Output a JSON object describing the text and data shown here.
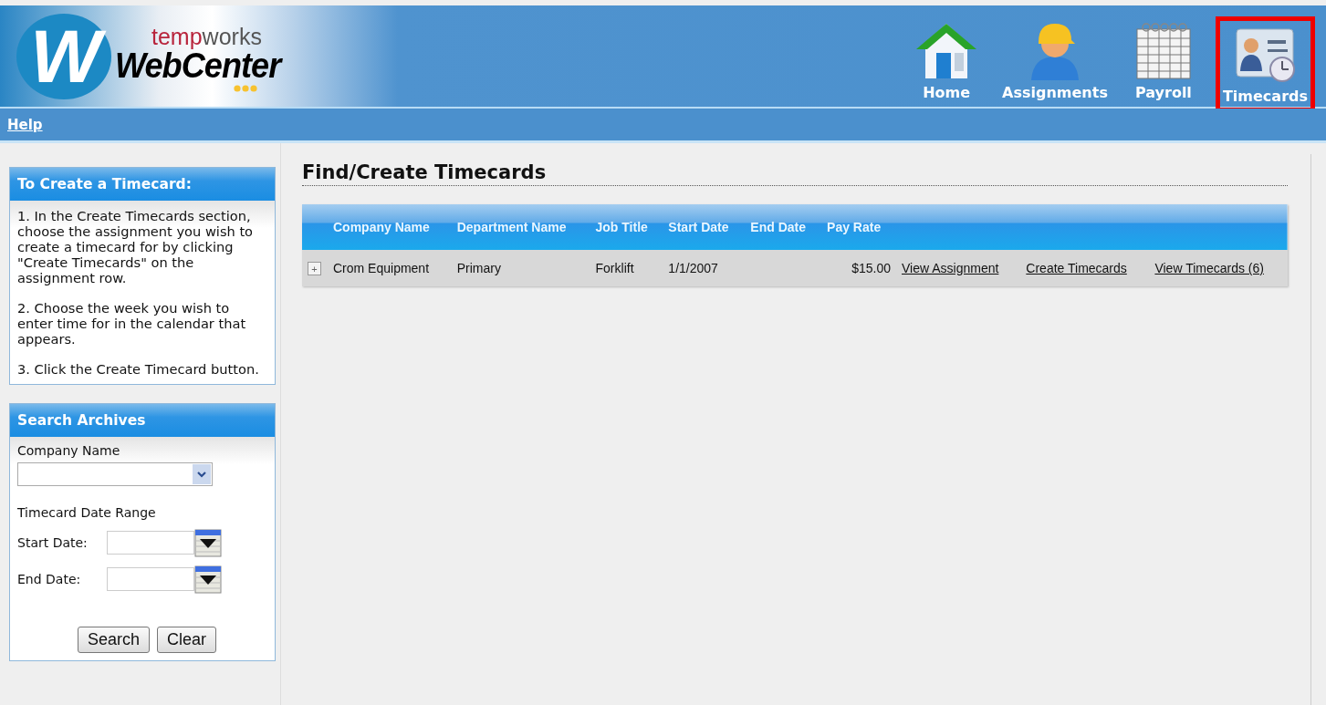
{
  "logo": {
    "letter": "W",
    "brand_part1": "temp",
    "brand_part2": "works",
    "product": "WebCenter"
  },
  "nav": [
    {
      "label": "Home",
      "kind": "house",
      "selected": false
    },
    {
      "label": "Assignments",
      "kind": "worker",
      "selected": false
    },
    {
      "label": "Payroll",
      "kind": "calendar",
      "selected": false
    },
    {
      "label": "Timecards",
      "kind": "card",
      "selected": true
    }
  ],
  "help_link": "Help",
  "instructions": {
    "title": "To Create a Timecard:",
    "steps": [
      "1. In the Create Timecards section, choose the assignment you wish to create a timecard for by clicking \"Create Timecards\" on the assignment row.",
      "2. Choose the week you wish to enter time for in the calendar that appears.",
      "3. Click the Create Timecard button."
    ]
  },
  "search_archives": {
    "title": "Search Archives",
    "company_label": "Company Name",
    "date_range_label": "Timecard Date Range",
    "start_label": "Start Date:",
    "end_label": "End Date:",
    "buttons": [
      "Search",
      "Clear"
    ]
  },
  "main": {
    "title": "Find/Create Timecards",
    "table": {
      "columns": [
        "Company Name",
        "Department Name",
        "Job Title",
        "Start Date",
        "End Date",
        "Pay Rate"
      ],
      "rows": [
        {
          "expander": "+",
          "cells": [
            "Crom Equipment",
            "Primary",
            "Forklift",
            "1/1/2007",
            "",
            "$15.00"
          ],
          "links": [
            "View Assignment",
            "Create Timecards",
            "View Timecards (6)"
          ]
        }
      ]
    }
  }
}
